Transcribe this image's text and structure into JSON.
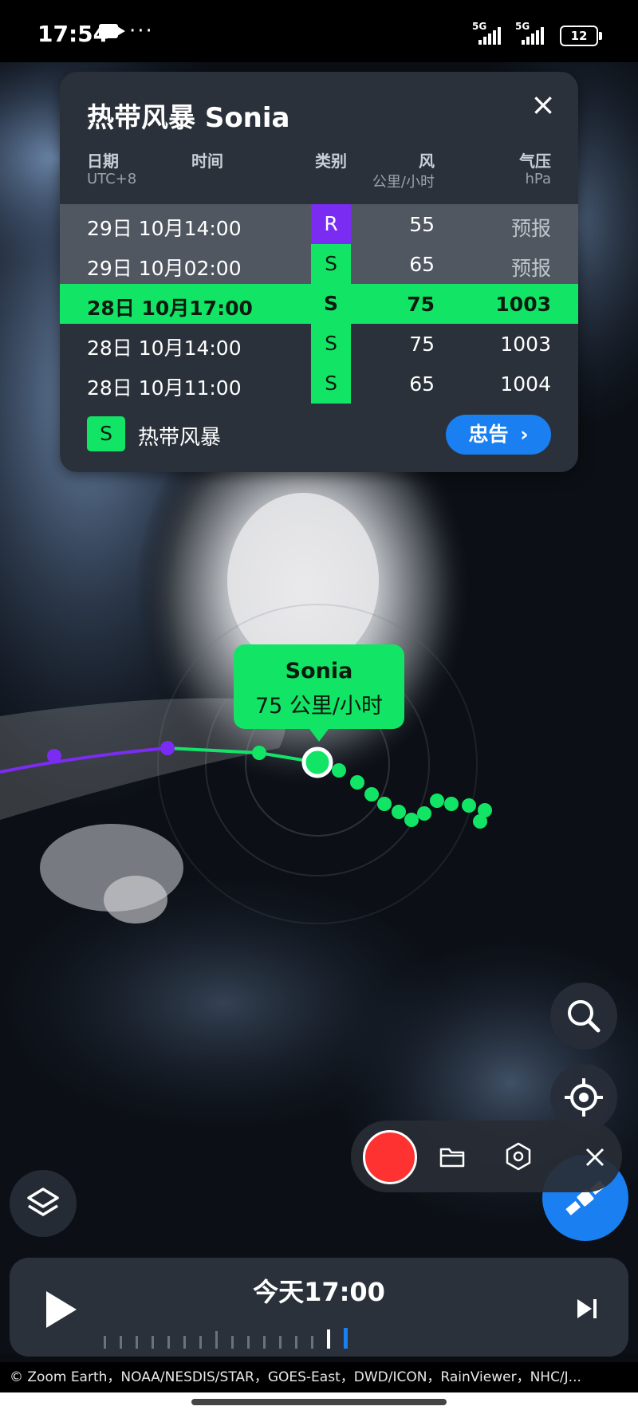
{
  "status_bar": {
    "time": "17:54",
    "battery": "12"
  },
  "storm_card": {
    "title": "热带风暴 Sonia",
    "headers": {
      "date": "日期",
      "time": "时间",
      "category": "类别",
      "wind": "风",
      "wind_unit": "公里/小时",
      "pressure": "气压",
      "pressure_unit": "hPa",
      "timezone": "UTC+8"
    },
    "rows": [
      {
        "date": "29日 10月14:00",
        "category": "R",
        "wind": "55",
        "pressure": "预报"
      },
      {
        "date": "29日 10月02:00",
        "category": "S",
        "wind": "65",
        "pressure": "预报"
      },
      {
        "date": "28日 10月17:00",
        "category": "S",
        "wind": "75",
        "pressure": "1003"
      },
      {
        "date": "28日 10月14:00",
        "category": "S",
        "wind": "75",
        "pressure": "1003"
      },
      {
        "date": "28日 10月11:00",
        "category": "S",
        "wind": "65",
        "pressure": "1004"
      }
    ],
    "legend": {
      "badge": "S",
      "label": "热带风暴"
    },
    "warning_button": "忠告"
  },
  "map_label": {
    "name": "Sonia",
    "speed": "75 公里/小时"
  },
  "timeline": {
    "time": "今天17:00"
  },
  "attribution": "© Zoom Earth，NOAA/NESDIS/STAR，GOES-East，DWD/ICON，RainViewer，NHC/J...",
  "colors": {
    "tropical_storm": "#12e565",
    "remnant": "#7a2cf2",
    "accent": "#1a7ff0"
  }
}
